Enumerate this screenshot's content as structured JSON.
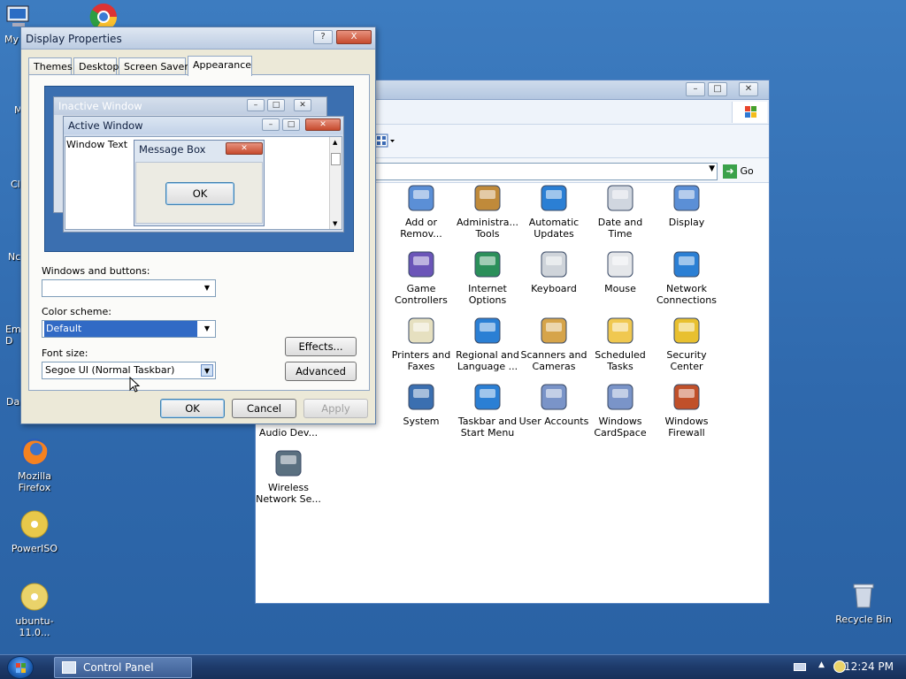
{
  "desktop": {
    "icons_left": [
      {
        "label": "My",
        "icon": "computer-icon"
      },
      {
        "label": "",
        "icon": "chrome-icon"
      },
      {
        "label": "M",
        "icon": "cut-icon"
      },
      {
        "label": "Cl",
        "icon": "cut-icon"
      },
      {
        "label": "Nc",
        "icon": "cut-icon"
      },
      {
        "label": "Em D",
        "icon": "cut-icon"
      },
      {
        "label": "Da",
        "icon": "cut-icon"
      },
      {
        "label": "Mozilla Firefox",
        "icon": "firefox-icon"
      },
      {
        "label": "PowerISO",
        "icon": "poweriso-icon"
      },
      {
        "label": "ubuntu-11.0...",
        "icon": "disc-icon"
      }
    ],
    "recycle_bin": "Recycle Bin"
  },
  "control_panel": {
    "go_label": "Go",
    "items": [
      {
        "label": "Add or Remov...",
        "icon": "add-remove-programs-icon"
      },
      {
        "label": "Administra... Tools",
        "icon": "administrative-tools-icon"
      },
      {
        "label": "Automatic Updates",
        "icon": "automatic-updates-icon"
      },
      {
        "label": "Date and Time",
        "icon": "date-time-icon"
      },
      {
        "label": "Display",
        "icon": "display-icon"
      },
      {
        "label": "Game Controllers",
        "icon": "game-controllers-icon"
      },
      {
        "label": "Internet Options",
        "icon": "internet-options-icon"
      },
      {
        "label": "Keyboard",
        "icon": "keyboard-icon"
      },
      {
        "label": "Mouse",
        "icon": "mouse-icon"
      },
      {
        "label": "Network Connections",
        "icon": "network-connections-icon"
      },
      {
        "label": "Printers and Faxes",
        "icon": "printers-icon"
      },
      {
        "label": "Regional and Language ...",
        "icon": "regional-icon"
      },
      {
        "label": "Scanners and Cameras",
        "icon": "scanners-icon"
      },
      {
        "label": "Scheduled Tasks",
        "icon": "scheduled-tasks-icon"
      },
      {
        "label": "Security Center",
        "icon": "security-center-icon"
      },
      {
        "label": "System",
        "icon": "system-icon"
      },
      {
        "label": "Taskbar and Start Menu",
        "icon": "taskbar-icon"
      },
      {
        "label": "User Accounts",
        "icon": "user-accounts-icon"
      },
      {
        "label": "Windows CardSpace",
        "icon": "cardspace-icon"
      },
      {
        "label": "Windows Firewall",
        "icon": "firewall-icon"
      },
      {
        "label": "Audio Dev...",
        "icon": "audio-devices-icon"
      },
      {
        "label": "Wireless Network Se...",
        "icon": "wireless-icon"
      }
    ]
  },
  "dialog": {
    "title": "Display Properties",
    "help": "?",
    "close": "X",
    "tabs": [
      "Themes",
      "Desktop",
      "Screen Saver",
      "Appearance"
    ],
    "active_tab": "Appearance",
    "preview": {
      "inactive": "Inactive Window",
      "active": "Active Window",
      "window_text": "Window Text",
      "message_box": "Message Box",
      "ok": "OK"
    },
    "windows_buttons_label": "Windows and buttons:",
    "windows_buttons_value": "",
    "color_scheme_label": "Color scheme:",
    "color_scheme_value": "Default",
    "font_size_label": "Font size:",
    "font_size_value": "Segoe UI (Normal Taskbar)",
    "effects": "Effects...",
    "advanced": "Advanced",
    "ok": "OK",
    "cancel": "Cancel",
    "apply": "Apply"
  },
  "taskbar": {
    "task": "Control Panel",
    "clock": "12:24 PM"
  },
  "colors": {
    "desktop": "#2f69ad",
    "selection": "#316ac5",
    "dialog_bg": "#ece9d8"
  }
}
